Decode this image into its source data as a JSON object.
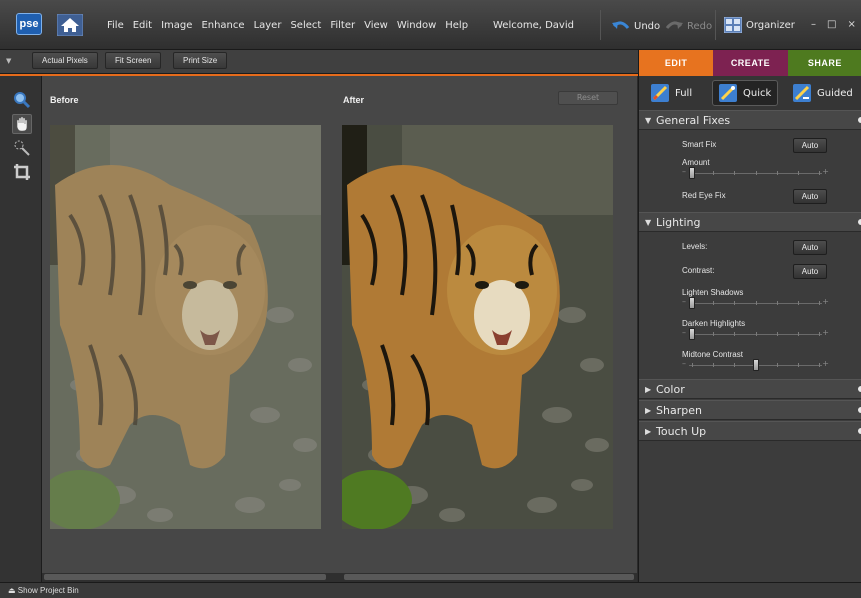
{
  "app": {
    "logo_text": "pse"
  },
  "menu": [
    "File",
    "Edit",
    "Image",
    "Enhance",
    "Layer",
    "Select",
    "Filter",
    "View",
    "Window",
    "Help"
  ],
  "welcome": "Welcome, David",
  "history": {
    "undo": "Undo",
    "redo": "Redo"
  },
  "organizer": "Organizer",
  "window_controls": {
    "minimize": "–",
    "maximize": "□",
    "close": "×"
  },
  "options_bar": {
    "actual_pixels": "Actual Pixels",
    "fit_screen": "Fit Screen",
    "print_size": "Print Size"
  },
  "canvas": {
    "before_label": "Before",
    "after_label": "After",
    "reset_label": "Reset"
  },
  "panel_tabs": [
    {
      "label": "EDIT",
      "color": "#e7731f"
    },
    {
      "label": "CREATE",
      "color": "#7d2251"
    },
    {
      "label": "SHARE",
      "color": "#4e7a1f"
    }
  ],
  "edit_modes": {
    "full": "Full",
    "quick": "Quick",
    "guided": "Guided",
    "active": "Quick"
  },
  "sections": {
    "general_fixes": {
      "title": "General Fixes",
      "smart_fix": "Smart Fix",
      "amount": "Amount",
      "red_eye_fix": "Red Eye Fix",
      "auto": "Auto"
    },
    "lighting": {
      "title": "Lighting",
      "levels": "Levels:",
      "contrast": "Contrast:",
      "lighten_shadows": "Lighten Shadows",
      "darken_highlights": "Darken Highlights",
      "midtone_contrast": "Midtone Contrast",
      "auto": "Auto"
    },
    "color": {
      "title": "Color"
    },
    "sharpen": {
      "title": "Sharpen"
    },
    "touch_up": {
      "title": "Touch Up"
    }
  },
  "slider_levels": {
    "amount": 0.0,
    "lighten_shadows": 0.0,
    "darken_highlights": 0.0,
    "midtone_contrast": 0.5
  },
  "slider_symbols": {
    "minus": "–",
    "plus": "+"
  },
  "status_bar": {
    "show_project_bin": "Show Project Bin"
  },
  "colors": {
    "accent": "#e66b1b"
  },
  "icons": {
    "zoom": "magnifier-icon",
    "hand": "hand-icon",
    "quick_select": "quick-selection-icon",
    "crop": "crop-icon",
    "home": "home-icon"
  }
}
